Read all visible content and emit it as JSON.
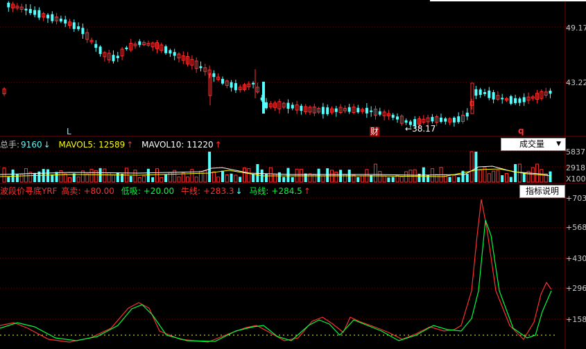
{
  "colors": {
    "up": "#ff3030",
    "down": "#54ffff",
    "grid": "#7a0000",
    "green": "#00ff40",
    "yellow": "#ffff00",
    "white": "#ffffff"
  },
  "price_panel": {
    "axis_labels": [
      "49.17",
      "43.22"
    ],
    "low_marker": "38.17",
    "event_tags": {
      "L": "L",
      "cai": "财",
      "q": "q"
    }
  },
  "volume_panel": {
    "total_label": "总手:",
    "total_value": "9160",
    "total_arrow": "↓",
    "ma5_label": "MAVOL5:",
    "ma5_value": "12589",
    "ma5_arrow": "↑",
    "ma10_label": "MAVOL10:",
    "ma10_value": "11220",
    "ma10_arrow": "↑",
    "dropdown_label": "成交量",
    "axis_labels": [
      "5837",
      "2918",
      "X100"
    ]
  },
  "indicator_panel": {
    "name": "波段价寻底YRF",
    "sell_label": "高卖:",
    "sell_value": "+80.00",
    "buy_label": "低吸:",
    "buy_value": "+20.00",
    "bull_label": "牛线:",
    "bull_value": "+283.3",
    "bull_arrow": "↓",
    "horse_label": "马线:",
    "horse_value": "+284.5",
    "horse_arrow": "↑",
    "explain_button": "指标说明",
    "axis_labels": [
      "+703",
      "+568",
      "+430",
      "+296",
      "+158"
    ]
  }
}
